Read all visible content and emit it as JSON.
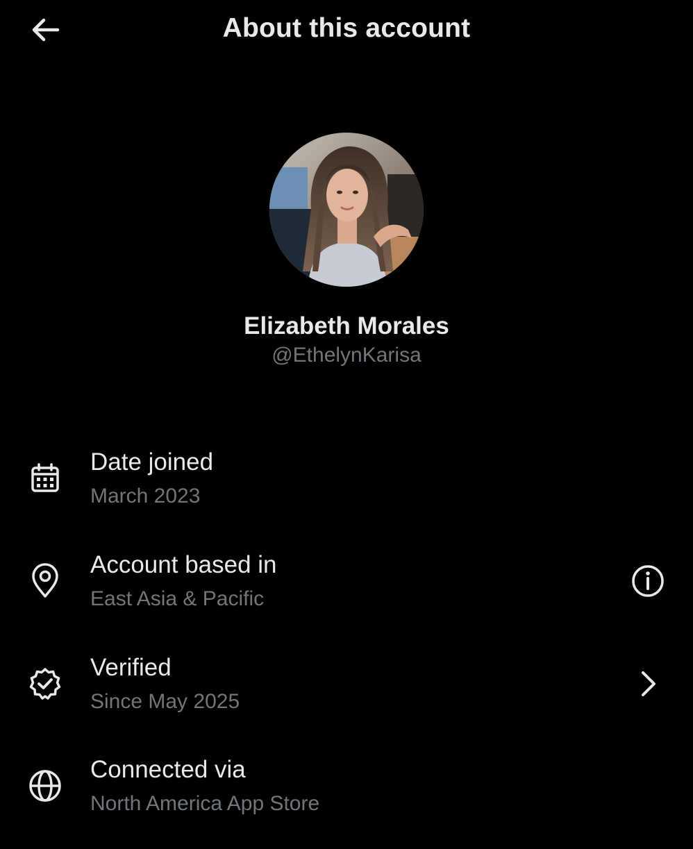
{
  "header": {
    "title": "About this account",
    "back_icon": "arrow-left-icon"
  },
  "profile": {
    "display_name": "Elizabeth Morales",
    "handle": "@EthelynKarisa",
    "avatar": "profile-photo"
  },
  "details": [
    {
      "icon": "calendar-icon",
      "label": "Date joined",
      "value": "March 2023"
    },
    {
      "icon": "location-pin-icon",
      "label": "Account based in",
      "value": "East Asia & Pacific",
      "action_icon": "info-icon"
    },
    {
      "icon": "verified-badge-icon",
      "label": "Verified",
      "value": "Since May 2025",
      "action_icon": "chevron-right-icon"
    },
    {
      "icon": "globe-icon",
      "label": "Connected via",
      "value": "North America App Store"
    }
  ],
  "colors": {
    "background": "#000000",
    "primary_text": "#e7e9ea",
    "secondary_text": "#71767b"
  }
}
